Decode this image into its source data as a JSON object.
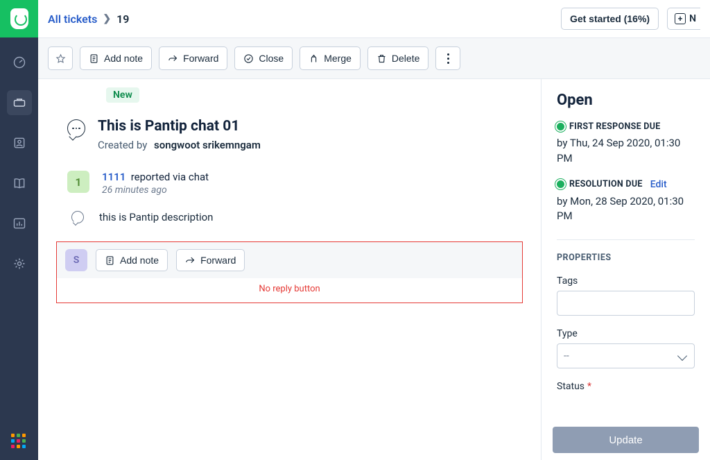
{
  "breadcrumb": {
    "root": "All tickets",
    "id": "19"
  },
  "header": {
    "get_started": "Get started (16%)",
    "new_label": "N"
  },
  "toolbar": {
    "add_note": "Add note",
    "forward": "Forward",
    "close": "Close",
    "merge": "Merge",
    "delete": "Delete"
  },
  "badge_new": "New",
  "ticket": {
    "title": "This is Pantip chat 01",
    "created_label": "Created by",
    "creator": "songwoot srikemngam"
  },
  "message": {
    "reporter": "1111",
    "via_text": "reported via chat",
    "time": "26 minutes ago",
    "description": "this is Pantip description",
    "avatar_letter": "1"
  },
  "action_bar": {
    "avatar": "S",
    "add_note": "Add note",
    "forward": "Forward"
  },
  "annotation": "No reply button",
  "sidebar": {
    "status_heading": "Open",
    "first_response_label": "FIRST RESPONSE DUE",
    "first_response_time": "by Thu, 24 Sep 2020, 01:30 PM",
    "resolution_label": "RESOLUTION DUE",
    "resolution_edit": "Edit",
    "resolution_time": "by Mon, 28 Sep 2020, 01:30 PM",
    "properties": "PROPERTIES",
    "tags_label": "Tags",
    "type_label": "Type",
    "type_value": "--",
    "status_label": "Status",
    "update": "Update"
  }
}
